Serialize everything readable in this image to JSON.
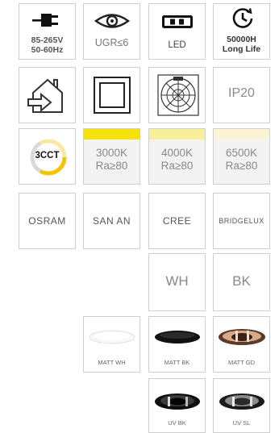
{
  "features": {
    "voltage": {
      "line1": "85-265V",
      "line2": "50-60Hz",
      "icon": "plug-icon"
    },
    "ugr": {
      "label": "UGR≤6",
      "icon": "eye-icon"
    },
    "led": {
      "label": "LED",
      "icon": "led-chip-icon"
    },
    "lifetime": {
      "line1": "50000H",
      "line2": "Long Life",
      "icon": "clock-icon"
    },
    "indoor": {
      "icon": "house-arrow-icon"
    },
    "square": {
      "icon": "square-frame-icon"
    },
    "angle": {
      "icon": "light-globe-icon"
    },
    "ip": {
      "label": "IP20"
    }
  },
  "cct": {
    "badge": "3CCT",
    "options": [
      {
        "kelvin": "3000K",
        "ra": "Ra≥80",
        "color": "#f5e10c"
      },
      {
        "kelvin": "4000K",
        "ra": "Ra≥80",
        "color": "#f8ef9a"
      },
      {
        "kelvin": "6500K",
        "ra": "Ra≥80",
        "color": "#fbf4d4"
      }
    ]
  },
  "chip_brands": [
    "OSRAM",
    "SAN AN",
    "CREE",
    "BRIDGELUX"
  ],
  "housing_colors": [
    "WH",
    "BK"
  ],
  "finishes": [
    {
      "label": "MATT WH",
      "color": "#f5f5f5"
    },
    {
      "label": "MATT BK",
      "color": "#111111"
    },
    {
      "label": "MATT GD",
      "color": "#b8866a"
    }
  ],
  "reflectors": [
    {
      "label": "UV BK"
    },
    {
      "label": "UV SL"
    }
  ]
}
